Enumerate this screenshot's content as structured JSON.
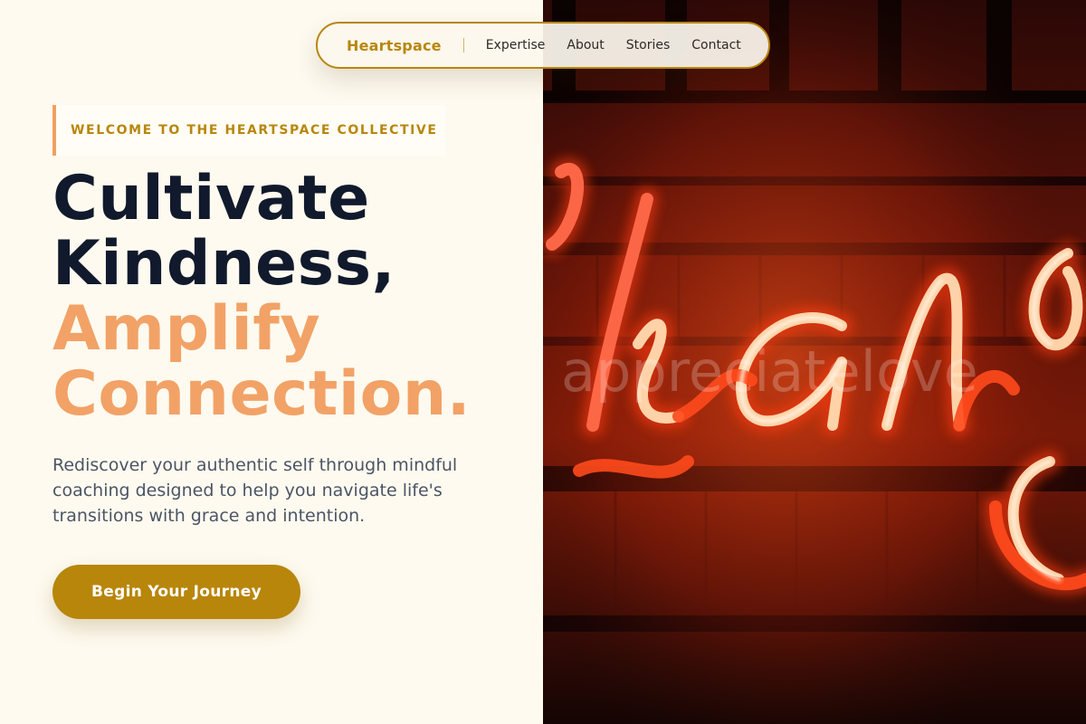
{
  "nav": {
    "brand": "Heartspace",
    "links": [
      "Expertise",
      "About",
      "Stories",
      "Contact"
    ]
  },
  "hero": {
    "eyebrow": "WELCOME TO THE HEARTSPACE COLLECTIVE",
    "headline_line1": "Cultivate",
    "headline_line2": "Kindness,",
    "headline_line3": "Amplify",
    "headline_line4": "Connection.",
    "description": "Rediscover your authentic self through mindful coaching designed to help you navigate life's transitions with grace and intention.",
    "cta_label": "Begin Your Journey",
    "image_watermark": "appreciatelove"
  },
  "colors": {
    "background": "#fefaef",
    "brand_gold": "#b8860b",
    "accent_peach": "#f2a266",
    "heading_navy": "#111a2c",
    "body_gray": "#4b5566",
    "neon_red": "#ff4a1c"
  },
  "icons": []
}
